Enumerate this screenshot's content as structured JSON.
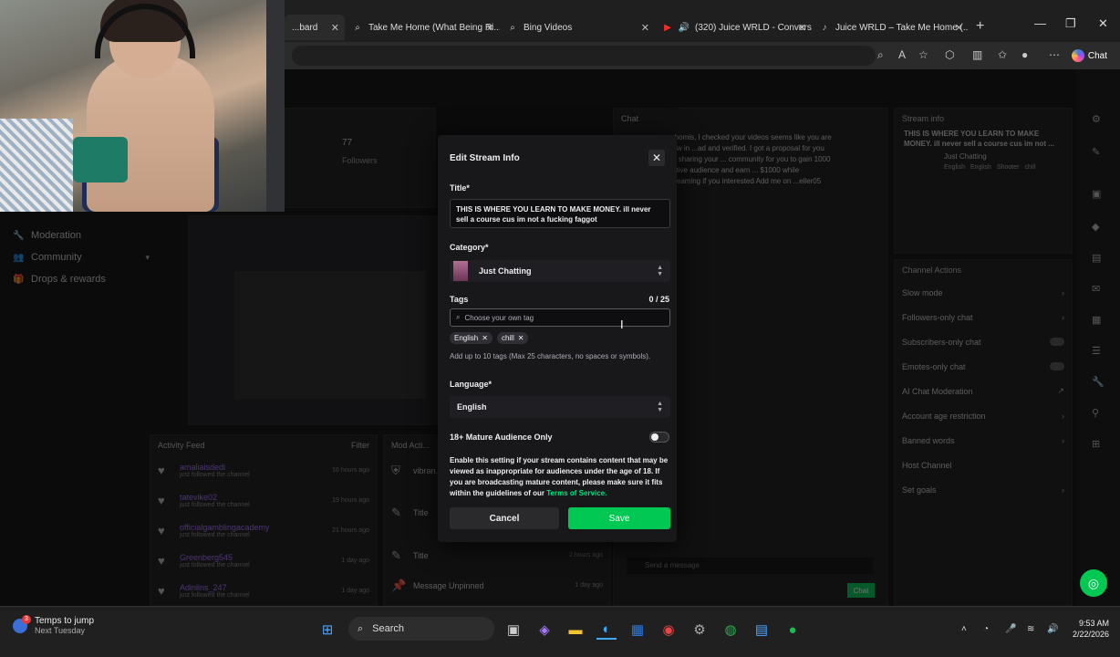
{
  "browser": {
    "tabs": [
      {
        "label": "...bard",
        "icon": "twitch-icon"
      },
      {
        "label": "Take Me Home (What Being Ri...",
        "icon": "search-icon"
      },
      {
        "label": "Bing Videos",
        "icon": "search-icon"
      },
      {
        "label": "(320) Juice WRLD - Convers...",
        "icon": "youtube-icon"
      },
      {
        "label": "Juice WRLD – Take Me Home (...",
        "icon": "youtube-icon"
      }
    ],
    "chat_label": "Chat"
  },
  "dashboard": {
    "side_nav": [
      {
        "label": "Moderation",
        "icon": "wrench-icon"
      },
      {
        "label": "Community",
        "icon": "people-icon"
      },
      {
        "label": "Drops & rewards",
        "icon": "gift-icon"
      }
    ],
    "followers_count": "77",
    "followers_label": "Followers",
    "activity_feed": {
      "title": "Activity Feed",
      "filter": "Filter",
      "items": [
        {
          "name": "amaliaisdedi",
          "sub": "just followed the channel",
          "time": "16 hours ago"
        },
        {
          "name": "tatevike02",
          "sub": "just followed the channel",
          "time": "19 hours ago"
        },
        {
          "name": "officialgamblingacademy",
          "sub": "just followed the channel",
          "time": "21 hours ago"
        },
        {
          "name": "Greenberg545",
          "sub": "just followed the channel",
          "time": "1 day ago"
        },
        {
          "name": "Adinlins_247",
          "sub": "just followed the channel",
          "time": "1 day ago"
        }
      ]
    },
    "mod_actions": {
      "title": "Mod Acti...",
      "items": [
        {
          "label": "vibran...",
          "time": ""
        },
        {
          "label": "Title",
          "time": ""
        },
        {
          "label": "Title",
          "time": "2 hours ago"
        },
        {
          "label": "Message Unpinned",
          "time": "1 day ago"
        }
      ]
    },
    "chat_title": "Chat",
    "chat_text": "...homis, I checked your videos seems like you are new in ...ad and verified. I got a proposal for you by sharing your ... community for you to gain 1000 active audience and earn ... $1000 while streaming if you interested Add me on ...eller05",
    "chat_placeholder": "Send a message",
    "chat_button": "Chat",
    "stream_info": {
      "title": "Stream info",
      "text": "THIS IS WHERE YOU LEARN TO MAKE MONEY. ill never sell a course cus im not ...",
      "category": "Just Chatting",
      "tags": [
        "English",
        "English",
        "Shooter",
        "chill"
      ]
    },
    "channel_actions": {
      "title": "Channel Actions",
      "items": [
        "Slow mode",
        "Followers-only chat",
        "Subscribers-only chat",
        "Emotes-only chat",
        "AI Chat Moderation",
        "Account age restriction",
        "Banned words",
        "Host Channel",
        "Set goals"
      ]
    }
  },
  "modal": {
    "title": "Edit Stream Info",
    "title_label": "Title*",
    "title_value": "THIS IS WHERE YOU LEARN TO MAKE MONEY. ill never sell a course cus im not a fucking faggot",
    "category_label": "Category*",
    "category_value": "Just Chatting",
    "tags_label": "Tags",
    "tags_count": "0 / 25",
    "tags_placeholder": "Choose your own tag",
    "tags": [
      "English",
      "chill"
    ],
    "tags_help": "Add up to 10 tags (Max 25 characters, no spaces or symbols).",
    "language_label": "Language*",
    "language_value": "English",
    "mature_label": "18+ Mature Audience Only",
    "mature_enabled": false,
    "mature_help": "Enable this setting if your stream contains content that may be viewed as inappropriate for audiences under the age of 18. If you are broadcasting mature content, please make sure it fits within the guidelines of our",
    "tos_link": "Terms of Service.",
    "cancel": "Cancel",
    "save": "Save"
  },
  "taskbar": {
    "weather_line1": "Temps to jump",
    "weather_line2": "Next Tuesday",
    "weather_badge": "3",
    "search": "Search",
    "time": "9:53 AM",
    "date": "2/22/2026"
  },
  "colors": {
    "accent_green": "#00c853",
    "twitch_purple": "#a970ff",
    "modal_bg": "#18181b"
  }
}
